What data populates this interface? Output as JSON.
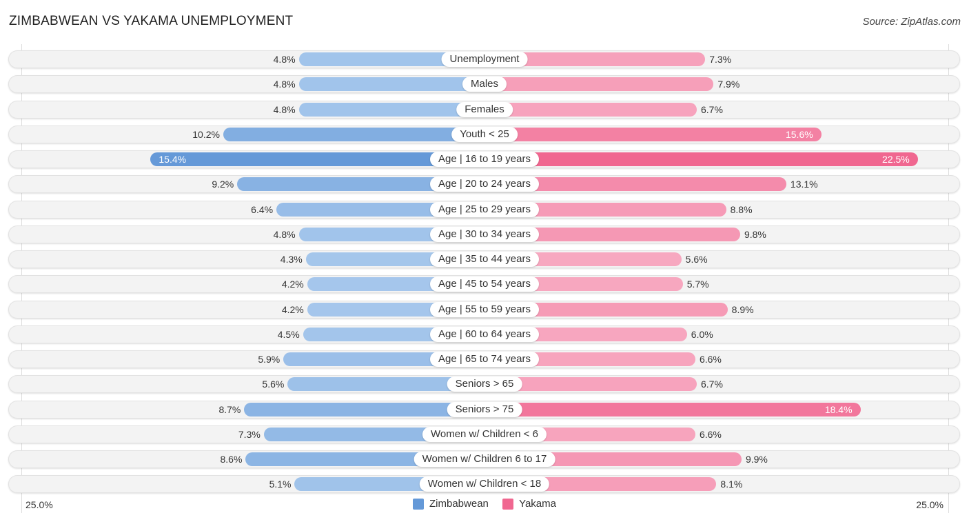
{
  "header": {
    "title": "ZIMBABWEAN VS YAKAMA UNEMPLOYMENT",
    "source": "Source: ZipAtlas.com"
  },
  "chart_data": {
    "type": "bar",
    "orientation": "horizontal-diverging",
    "title": "ZIMBABWEAN VS YAKAMA UNEMPLOYMENT",
    "xlim": [
      -25.0,
      25.0
    ],
    "axis_labels": {
      "left": "25.0%",
      "right": "25.0%"
    },
    "legend": {
      "placement": "bottom-center"
    },
    "categories": [
      "Unemployment",
      "Males",
      "Females",
      "Youth < 25",
      "Age | 16 to 19 years",
      "Age | 20 to 24 years",
      "Age | 25 to 29 years",
      "Age | 30 to 34 years",
      "Age | 35 to 44 years",
      "Age | 45 to 54 years",
      "Age | 55 to 59 years",
      "Age | 60 to 64 years",
      "Age | 65 to 74 years",
      "Seniors > 65",
      "Seniors > 75",
      "Women w/ Children < 6",
      "Women w/ Children 6 to 17",
      "Women w/ Children < 18"
    ],
    "series": [
      {
        "name": "Zimbabwean",
        "color": "#6499d8",
        "side": "left",
        "values": [
          4.8,
          4.8,
          4.8,
          10.2,
          15.4,
          9.2,
          6.4,
          4.8,
          4.3,
          4.2,
          4.2,
          4.5,
          5.9,
          5.6,
          8.7,
          7.3,
          8.6,
          5.1
        ],
        "labels": [
          "4.8%",
          "4.8%",
          "4.8%",
          "10.2%",
          "15.4%",
          "9.2%",
          "6.4%",
          "4.8%",
          "4.3%",
          "4.2%",
          "4.2%",
          "4.5%",
          "5.9%",
          "5.6%",
          "8.7%",
          "7.3%",
          "8.6%",
          "5.1%"
        ]
      },
      {
        "name": "Yakama",
        "color": "#f06790",
        "side": "right",
        "values": [
          7.3,
          7.9,
          6.7,
          15.6,
          22.5,
          13.1,
          8.8,
          9.8,
          5.6,
          5.7,
          8.9,
          6.0,
          6.6,
          6.7,
          18.4,
          6.6,
          9.9,
          8.1
        ],
        "labels": [
          "7.3%",
          "7.9%",
          "6.7%",
          "15.6%",
          "22.5%",
          "13.1%",
          "8.8%",
          "9.8%",
          "5.6%",
          "5.7%",
          "8.9%",
          "6.0%",
          "6.6%",
          "6.7%",
          "18.4%",
          "6.6%",
          "9.9%",
          "8.1%"
        ]
      }
    ]
  },
  "legend": {
    "items": [
      {
        "label": "Zimbabwean",
        "color": "#6499d8"
      },
      {
        "label": "Yakama",
        "color": "#f06790"
      }
    ]
  }
}
